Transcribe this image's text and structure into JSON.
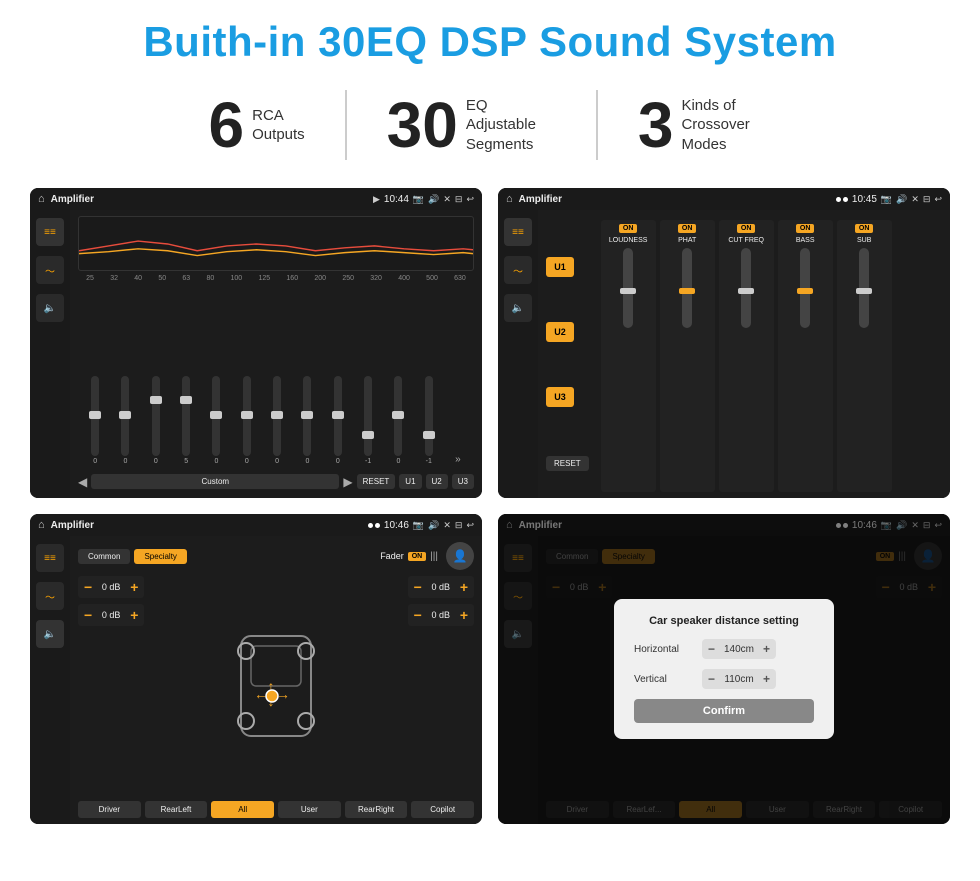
{
  "header": {
    "title": "Buith-in 30EQ DSP Sound System"
  },
  "stats": [
    {
      "number": "6",
      "label_line1": "RCA",
      "label_line2": "Outputs"
    },
    {
      "number": "30",
      "label_line1": "EQ Adjustable",
      "label_line2": "Segments"
    },
    {
      "number": "3",
      "label_line1": "Kinds of",
      "label_line2": "Crossover Modes"
    }
  ],
  "screens": {
    "screen1": {
      "app_name": "Amplifier",
      "time": "10:44",
      "preset": "Custom",
      "modes": [
        "U1",
        "U2",
        "U3"
      ],
      "reset_label": "RESET",
      "eq_values": [
        "0",
        "0",
        "0",
        "5",
        "0",
        "0",
        "0",
        "0",
        "0",
        "-1",
        "0",
        "-1"
      ],
      "freq_labels": [
        "25",
        "32",
        "40",
        "50",
        "63",
        "80",
        "100",
        "125",
        "160",
        "200",
        "250",
        "320",
        "400",
        "500",
        "630"
      ]
    },
    "screen2": {
      "app_name": "Amplifier",
      "time": "10:45",
      "channels": [
        "LOUDNESS",
        "PHAT",
        "CUT FREQ",
        "BASS",
        "SUB"
      ],
      "u_labels": [
        "U1",
        "U2",
        "U3"
      ],
      "reset_label": "RESET"
    },
    "screen3": {
      "app_name": "Amplifier",
      "time": "10:46",
      "tabs": [
        "Common",
        "Specialty"
      ],
      "fader_label": "Fader",
      "on_label": "ON",
      "vol_values": [
        "0 dB",
        "0 dB",
        "0 dB",
        "0 dB"
      ],
      "bottom_btns": [
        "Driver",
        "RearLeft",
        "All",
        "User",
        "RearRight",
        "Copilot"
      ]
    },
    "screen4": {
      "app_name": "Amplifier",
      "time": "10:46",
      "tabs": [
        "Common",
        "Specialty"
      ],
      "dialog": {
        "title": "Car speaker distance setting",
        "horizontal_label": "Horizontal",
        "horizontal_value": "140cm",
        "vertical_label": "Vertical",
        "vertical_value": "110cm",
        "confirm_label": "Confirm"
      },
      "bottom_btns": [
        "Driver",
        "RearLef...",
        "All",
        "User",
        "RearRight",
        "Copilot"
      ],
      "vol_values": [
        "0 dB",
        "0 dB"
      ]
    }
  }
}
